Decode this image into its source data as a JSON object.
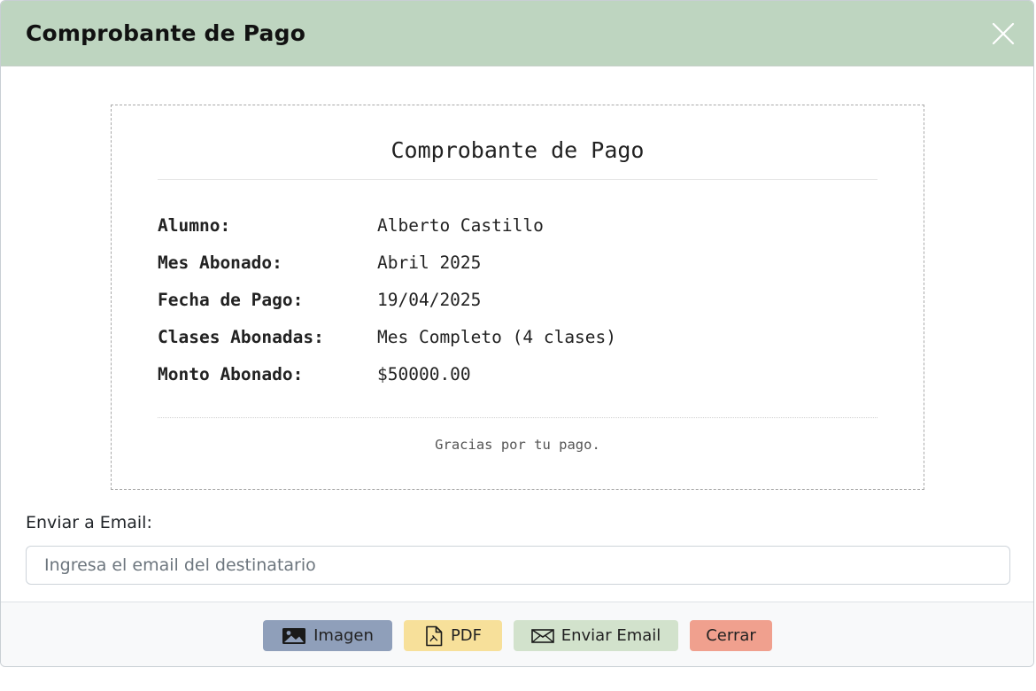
{
  "modal": {
    "title": "Comprobante de Pago"
  },
  "receipt": {
    "title": "Comprobante de Pago",
    "rows": [
      {
        "label": "Alumno:",
        "value": "Alberto Castillo"
      },
      {
        "label": "Mes Abonado:",
        "value": "Abril 2025"
      },
      {
        "label": "Fecha de Pago:",
        "value": "19/04/2025"
      },
      {
        "label": "Clases Abonadas:",
        "value": "Mes Completo (4 clases)"
      },
      {
        "label": "Monto Abonado:",
        "value": "$50000.00"
      }
    ],
    "footer": "Gracias por tu pago."
  },
  "email": {
    "label": "Enviar a Email:",
    "placeholder": "Ingresa el email del destinatario",
    "value": ""
  },
  "buttons": {
    "imagen": {
      "label": "Imagen",
      "icon": "image-icon"
    },
    "pdf": {
      "label": "PDF",
      "icon": "file-pdf-icon"
    },
    "email": {
      "label": "Enviar Email",
      "icon": "envelope-icon"
    },
    "cerrar": {
      "label": "Cerrar"
    }
  },
  "colors": {
    "header": "#bed5c0",
    "imagen": "#8f9fba",
    "pdf": "#f7e09a",
    "email": "#d2e2cc",
    "cerrar": "#f0a08e"
  }
}
